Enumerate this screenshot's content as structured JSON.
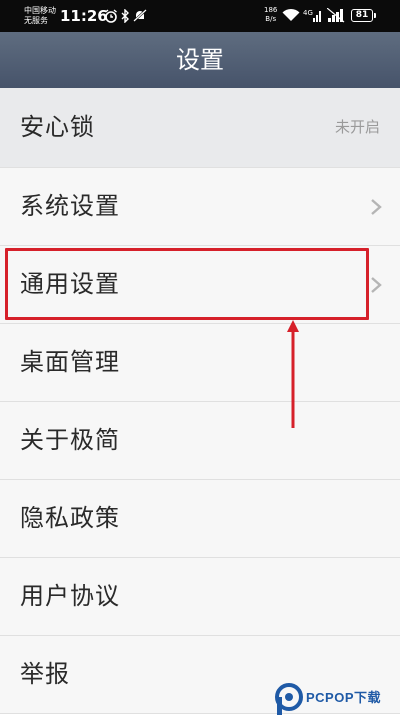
{
  "status_bar": {
    "carrier_line1": "中国移动",
    "carrier_line2": "无服务",
    "time": "11:26",
    "net_speed_value": "186",
    "net_speed_unit": "B/s",
    "battery": "81",
    "icons": [
      "alarm-icon",
      "bluetooth-icon",
      "mute-icon",
      "wifi-icon",
      "signal-4g-icon",
      "signal-icon"
    ]
  },
  "header": {
    "title": "设置"
  },
  "list": {
    "items": [
      {
        "label": "安心锁",
        "status": "未开启"
      },
      {
        "label": "系统设置"
      },
      {
        "label": "通用设置"
      },
      {
        "label": "桌面管理"
      },
      {
        "label": "关于极简"
      },
      {
        "label": "隐私政策"
      },
      {
        "label": "用户协议"
      },
      {
        "label": "举报"
      }
    ]
  },
  "annotation": {
    "highlight_color": "#d6202a"
  },
  "watermark": {
    "text": "PCPOP下载"
  },
  "colors": {
    "header": "#4f5c72",
    "list_bg": "#f7f7f7",
    "first_row_bg": "#e9eaec"
  }
}
